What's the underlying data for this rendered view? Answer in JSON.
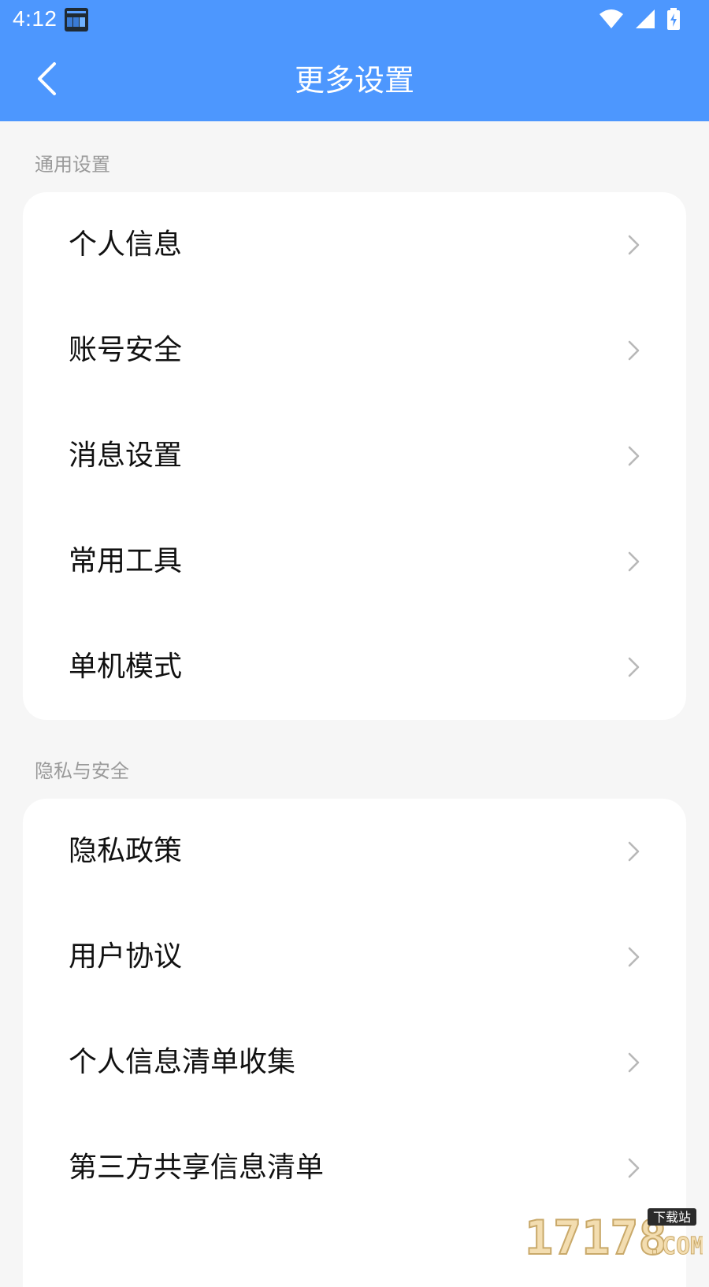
{
  "status_bar": {
    "time": "4:12",
    "icons": [
      "app-notification-icon",
      "wifi-icon",
      "signal-icon",
      "battery-charging-icon"
    ]
  },
  "nav": {
    "back_icon": "back-arrow-icon",
    "title": "更多设置"
  },
  "sections": [
    {
      "title": "通用设置",
      "items": [
        {
          "label": "个人信息"
        },
        {
          "label": "账号安全"
        },
        {
          "label": "消息设置"
        },
        {
          "label": "常用工具"
        },
        {
          "label": "单机模式"
        }
      ]
    },
    {
      "title": "隐私与安全",
      "items": [
        {
          "label": "隐私政策"
        },
        {
          "label": "用户协议"
        },
        {
          "label": "个人信息清单收集"
        },
        {
          "label": "第三方共享信息清单"
        }
      ]
    }
  ],
  "watermark": {
    "text": "17178",
    "sub": "下载站",
    "suffix": ".COM"
  },
  "colors": {
    "header": "#4d97fe",
    "background": "#f6f6f6",
    "card": "#ffffff",
    "section_title": "#9a9a9a",
    "row_text": "#111111",
    "chevron": "#b8b8b8"
  }
}
